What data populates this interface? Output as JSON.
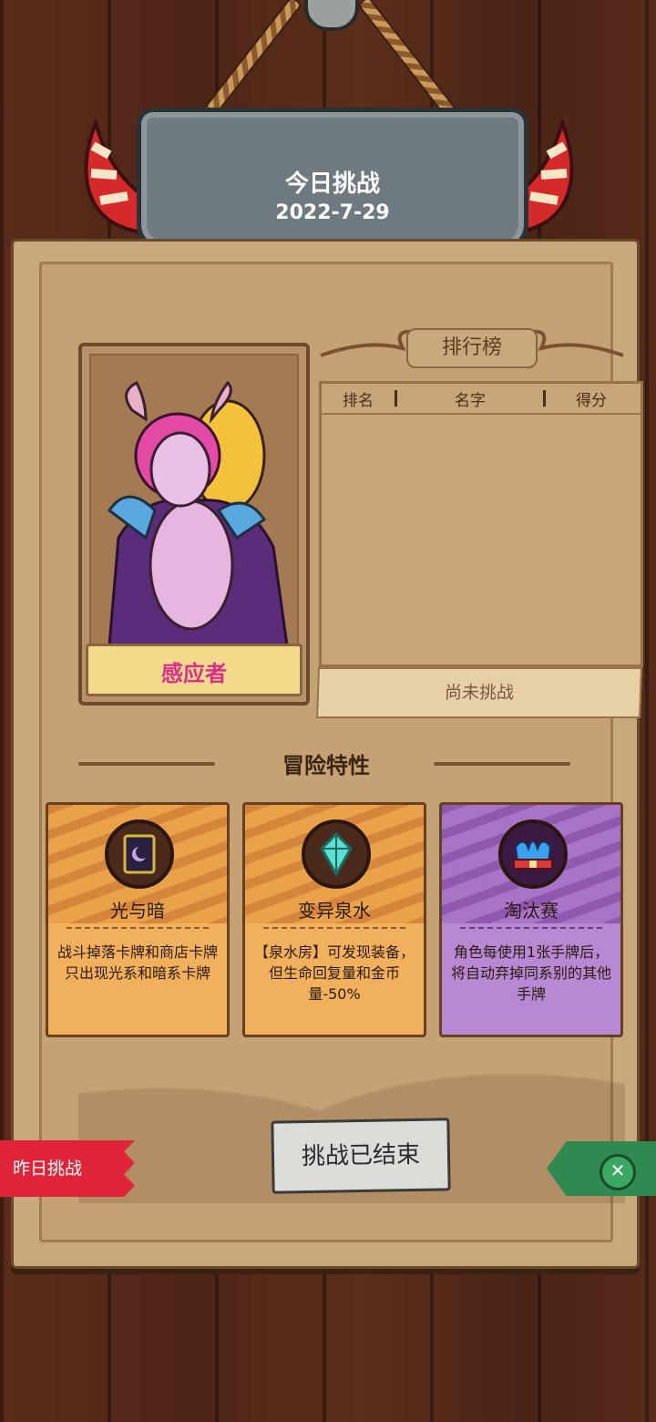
{
  "header": {
    "title": "今日挑战",
    "date": "2022-7-29"
  },
  "character": {
    "name": "感应者"
  },
  "leaderboard": {
    "title": "排行榜",
    "columns": [
      "排名",
      "名字",
      "得分"
    ],
    "rows": [],
    "status": "尚未挑战"
  },
  "traits": {
    "title": "冒险特性",
    "cards": [
      {
        "name": "光与暗",
        "desc": "战斗掉落卡牌和商店卡牌只出现光系和暗系卡牌",
        "icon": "light-dark-card-icon",
        "color": "#f0b05c"
      },
      {
        "name": "变异泉水",
        "desc": "【泉水房】可发现装备，但生命回复量和金币量-50%",
        "icon": "crystal-icon",
        "color": "#f0b05c"
      },
      {
        "name": "淘汰赛",
        "desc": "角色每使用1张手牌后，将自动弃掉同系别的其他手牌",
        "icon": "crown-icon",
        "color": "#b789d2"
      }
    ]
  },
  "actions": {
    "end_button": "挑战已结束",
    "yesterday": "昨日挑战"
  }
}
